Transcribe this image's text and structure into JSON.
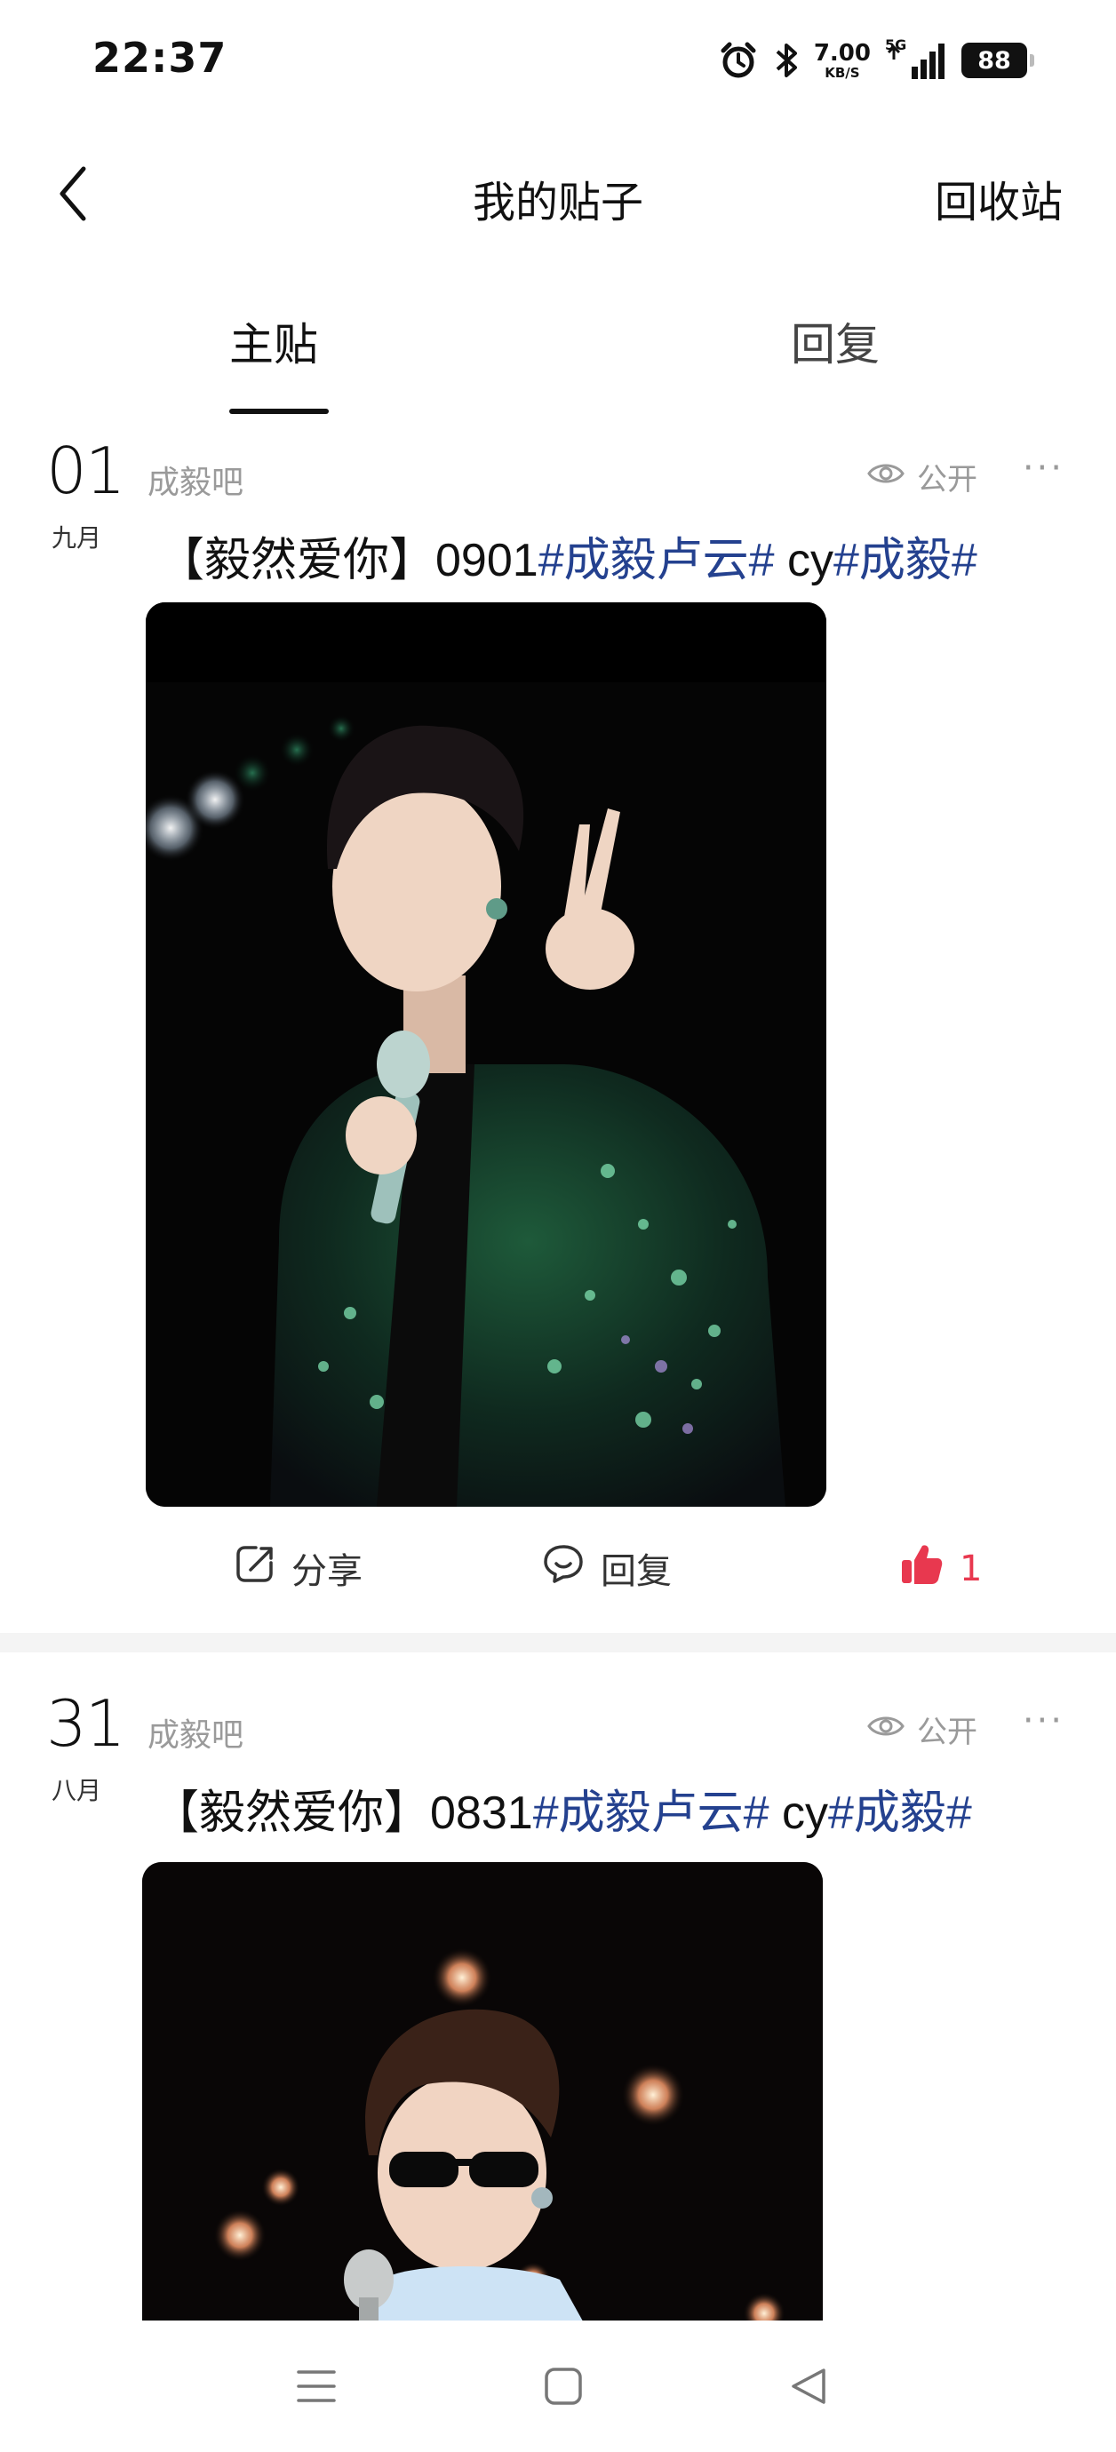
{
  "status_bar": {
    "time": "22:37",
    "net_speed": "7.00",
    "net_unit": "KB/S",
    "network": "5G",
    "battery": "88"
  },
  "header": {
    "title": "我的贴子",
    "recycle_label": "回收站"
  },
  "tabs": {
    "main_label": "主贴",
    "reply_label": "回复",
    "active": "主贴"
  },
  "posts": [
    {
      "day": "01",
      "month": "九月",
      "forum": "成毅吧",
      "visibility": "公开",
      "more": "···",
      "title_prefix": "【毅然爱你】0901",
      "tag1": "#成毅卢云#",
      "middle": " cy",
      "tag2": "#成毅#",
      "share_label": "分享",
      "reply_label": "回复",
      "like_count": "1"
    },
    {
      "day": "31",
      "month": "八月",
      "forum": "成毅吧",
      "visibility": "公开",
      "more": "···",
      "title_prefix": "【毅然爱你】0831",
      "tag1": "#成毅卢云#",
      "middle": " cy",
      "tag2": "#成毅#"
    }
  ],
  "colors": {
    "tag": "#24418f",
    "like": "#e8384f",
    "muted": "#9a9a9a"
  },
  "icons": {
    "alarm": "alarm-icon",
    "bluetooth": "bluetooth-icon",
    "signal": "signal-icon",
    "back": "chevron-left-icon",
    "eye": "eye-icon",
    "share": "share-icon",
    "reply": "comment-icon",
    "like": "thumbs-up-icon",
    "nav_menu": "menu-icon",
    "nav_home": "home-square-icon",
    "nav_back": "back-triangle-icon"
  }
}
